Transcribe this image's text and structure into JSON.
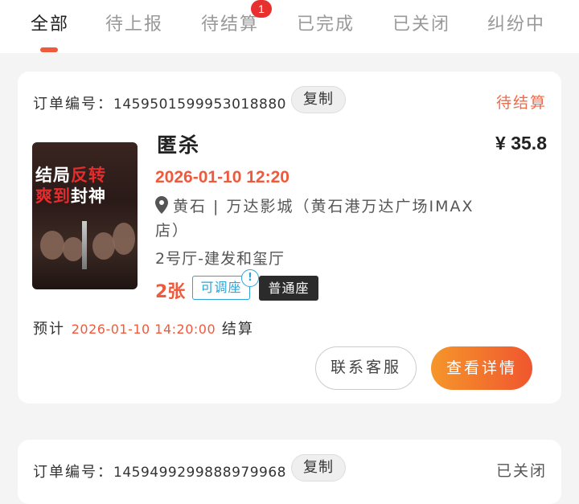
{
  "tabs": [
    {
      "label": "全部",
      "active": true
    },
    {
      "label": "待上报"
    },
    {
      "label": "待结算",
      "badge": "1"
    },
    {
      "label": "已完成"
    },
    {
      "label": "已关闭"
    },
    {
      "label": "纠纷中"
    }
  ],
  "orders": [
    {
      "order_label": "订单编号：",
      "order_no": "1459501599953018880",
      "copy_label": "复制",
      "status": "待结算",
      "poster_text": {
        "line1_a": "结局",
        "line1_b": "反转",
        "line2_a": "爽到",
        "line2_b": "封神"
      },
      "title": "匿杀",
      "price": "¥ 35.8",
      "showtime": "2026-01-10  12:20",
      "location": "黄石 | 万达影城（黄石港万达广场IMAX店）",
      "hall": "2号厅-建发和玺厅",
      "qty": "2张",
      "seat_adjustable": "可调座",
      "info_mark": "!",
      "seat_type": "普通座",
      "settle_prefix": "预计",
      "settle_date": "2026-01-10  14:20:00",
      "settle_suffix": "结算",
      "contact_label": "联系客服",
      "detail_label": "查看详情"
    },
    {
      "order_label": "订单编号：",
      "order_no": "1459499299888979968",
      "copy_label": "复制",
      "status": "已关闭"
    }
  ],
  "colors": {
    "accent": "#ef5a3c",
    "badge": "#e8312e",
    "seat_adjustable": "#2ea3d8",
    "detail_gradient_start": "#f5962a",
    "detail_gradient_end": "#f0562f"
  },
  "icons": [
    "location-pin-icon",
    "info-icon"
  ]
}
